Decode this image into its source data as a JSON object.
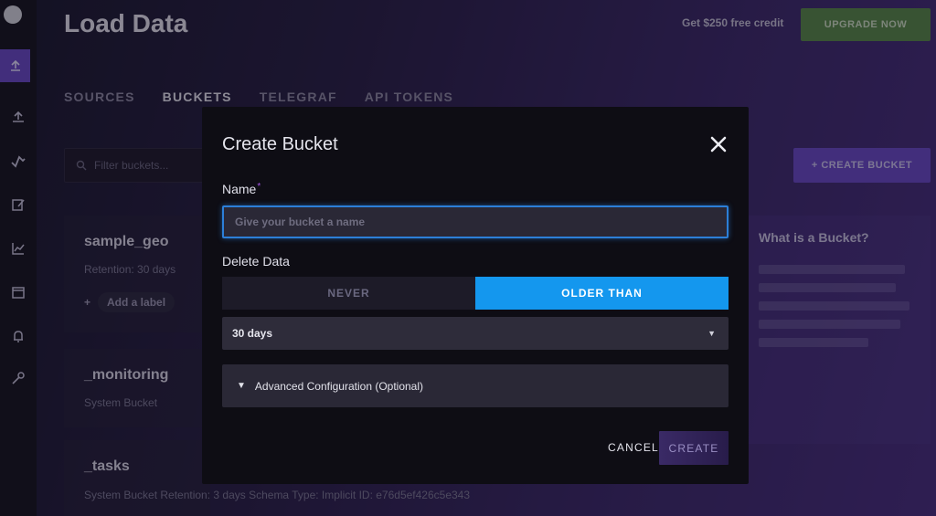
{
  "background": {
    "page_title": "Load Data",
    "header_credit": "Get $250 free credit",
    "header_button": "UPGRADE NOW",
    "tabs": [
      {
        "label": "SOURCES",
        "active": false
      },
      {
        "label": "BUCKETS",
        "active": true
      },
      {
        "label": "TELEGRAF",
        "active": false
      },
      {
        "label": "API TOKENS",
        "active": false
      }
    ],
    "filter_placeholder": "Filter buckets...",
    "create_bucket_button": "+ CREATE BUCKET",
    "buckets": [
      {
        "name": "sample_geo",
        "meta": "Retention: 30 days",
        "add_label": "Add a label"
      },
      {
        "name": "_monitoring",
        "meta": "System Bucket"
      },
      {
        "name": "_tasks",
        "meta": "System Bucket   Retention: 3 days   Schema Type: Implicit   ID: e76d5ef426c5e343"
      }
    ],
    "side_panel_title": "What is a Bucket?"
  },
  "modal": {
    "title": "Create Bucket",
    "name_label": "Name",
    "name_required_mark": "*",
    "name_placeholder": "Give your bucket a name",
    "name_value": "",
    "delete_label": "Delete Data",
    "delete_options": [
      "NEVER",
      "OLDER THAN"
    ],
    "delete_selected": "OLDER THAN",
    "retention_selected": "30 days",
    "advanced_label": "Advanced Configuration (Optional)",
    "cancel_label": "CANCEL",
    "create_label": "CREATE"
  },
  "colors": {
    "accent_blue": "#1497ee",
    "focus_border": "#2c7fd8",
    "create_button": "#3a2a66",
    "required_mark": "#a455e6"
  },
  "icons": {
    "close": "close-icon",
    "dropdown": "caret-down-icon",
    "advanced_toggle": "triangle-down-icon",
    "search": "search-icon"
  }
}
